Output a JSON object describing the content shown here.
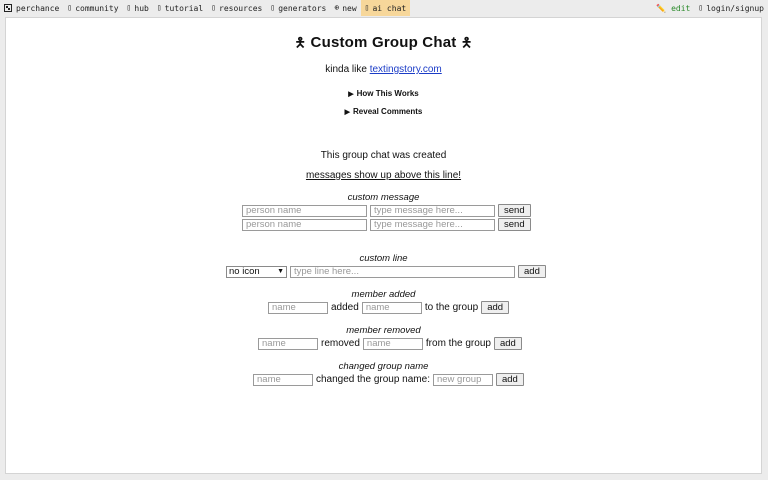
{
  "nav": {
    "items": [
      {
        "label": "perchance",
        "icon": "dice-icon"
      },
      {
        "label": "community",
        "icon": "people-icon"
      },
      {
        "label": "hub",
        "icon": "hub-icon"
      },
      {
        "label": "tutorial",
        "icon": "book-icon"
      },
      {
        "label": "resources",
        "icon": "folder-icon"
      },
      {
        "label": "generators",
        "icon": "gear-icon"
      },
      {
        "label": "new",
        "icon": "plus-circle-icon"
      },
      {
        "label": "ai chat",
        "icon": "chat-icon"
      }
    ],
    "edit_label": "✏️ edit",
    "login_label": "login/signup"
  },
  "page": {
    "title": "Custom Group Chat",
    "subtitle_prefix": "kinda like",
    "subtitle_link": "textingstory.com",
    "details_1": "How This Works",
    "details_2": "Reveal Comments",
    "created_msg": "This group chat was created",
    "above_line": "messages show up above this line!"
  },
  "custom_message": {
    "label": "custom message",
    "person_placeholder": "person name",
    "message_placeholder": "type message here...",
    "send_label": "send"
  },
  "custom_line": {
    "label": "custom line",
    "select_value": "no icon",
    "line_placeholder": "type line here...",
    "add_label": "add"
  },
  "member_added": {
    "label": "member added",
    "name_placeholder": "name",
    "word_added": "added",
    "name2_placeholder": "name",
    "word_to_group": "to the group",
    "add_label": "add"
  },
  "member_removed": {
    "label": "member removed",
    "name_placeholder": "name",
    "word_removed": "removed",
    "name2_placeholder": "name",
    "word_from_group": "from the group",
    "add_label": "add"
  },
  "changed_name": {
    "label": "changed group name",
    "name_placeholder": "name",
    "word_changed": "changed the group name:",
    "group_placeholder": "new group",
    "add_label": "add"
  }
}
